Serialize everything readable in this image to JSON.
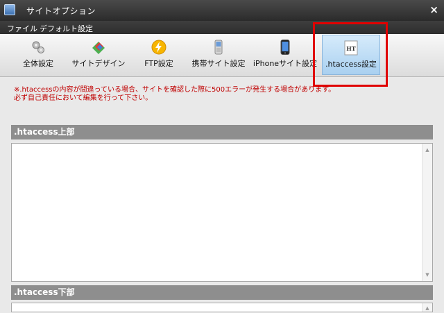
{
  "window": {
    "title": "サイトオプション",
    "close": "×"
  },
  "menu": {
    "file": "ファイル",
    "default_settings": "デフォルト設定"
  },
  "toolbar": {
    "items": [
      {
        "label": "全体設定",
        "icon": "gears-icon"
      },
      {
        "label": "サイトデザイン",
        "icon": "design-icon"
      },
      {
        "label": "FTP設定",
        "icon": "lightning-icon"
      },
      {
        "label": "携帯サイト設定",
        "icon": "mobile-phone-icon"
      },
      {
        "label": "iPhoneサイト設定",
        "icon": "iphone-icon"
      },
      {
        "label": ".htaccess設定",
        "icon": "htaccess-icon",
        "icon_text": "HT",
        "active": true
      }
    ]
  },
  "warning": {
    "line1": "※.htaccessの内容が間違っている場合、サイトを確認した際に500エラーが発生する場合があります。",
    "line2": "必ず自己責任において編集を行って下さい。"
  },
  "sections": {
    "upper": {
      "title": ".htaccess上部",
      "value": ""
    },
    "lower": {
      "title": ".htaccess下部",
      "value": ""
    }
  },
  "colors": {
    "highlight": "#e00000",
    "warning_text": "#c00000",
    "section_header": "#8e8e8e",
    "active_tab": "#a9d0f0"
  }
}
